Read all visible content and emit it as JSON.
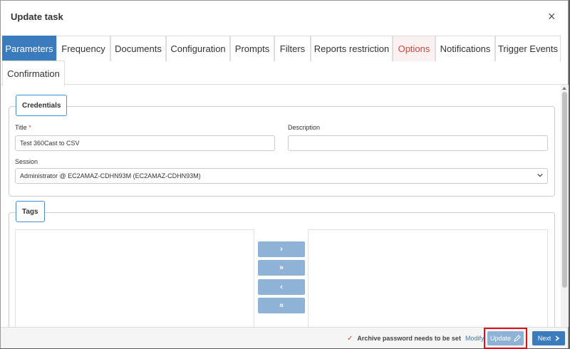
{
  "dialog": {
    "title": "Update task",
    "close_glyph": "×"
  },
  "tabs": [
    {
      "label": "Parameters",
      "active": true
    },
    {
      "label": "Frequency"
    },
    {
      "label": "Documents"
    },
    {
      "label": "Configuration"
    },
    {
      "label": "Prompts"
    },
    {
      "label": "Filters"
    },
    {
      "label": "Reports restriction"
    },
    {
      "label": "Options",
      "highlight": true
    },
    {
      "label": "Notifications"
    },
    {
      "label": "Trigger Events"
    },
    {
      "label": "Confirmation"
    }
  ],
  "credentials": {
    "legend": "Credentials",
    "title_label": "Title",
    "title_required_mark": "*",
    "title_value": "Test 360Cast to CSV",
    "description_label": "Description",
    "description_value": "",
    "session_label": "Session",
    "session_value": "Administrator @ EC2AMAZ-CDHN93M (EC2AMAZ-CDHN93M)"
  },
  "tags": {
    "legend": "Tags",
    "buttons": [
      "›",
      "»",
      "‹",
      "«"
    ]
  },
  "footer": {
    "check_glyph": "✓",
    "warning": "Archive password needs to be set",
    "modify_link": "Modify",
    "update_label": "Update",
    "next_label": "Next"
  },
  "colors": {
    "primary": "#3a7bbd",
    "disabled": "#8fb3d7",
    "danger": "#d0443e",
    "highlight_border": "#e0101a"
  }
}
